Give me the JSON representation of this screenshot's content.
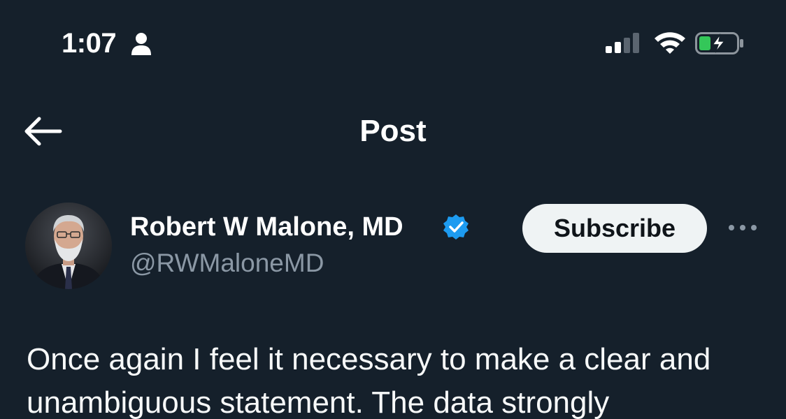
{
  "status_bar": {
    "time": "1:07",
    "icons": [
      "person-icon",
      "cellular-signal-icon",
      "wifi-icon",
      "battery-charging-icon"
    ],
    "battery_color": "#34c759"
  },
  "header": {
    "back_icon": "arrow-left-icon",
    "title": "Post"
  },
  "post": {
    "author": {
      "name": "Robert W Malone, MD",
      "handle": "@RWMaloneMD",
      "verified": true,
      "verified_color": "#1d9bf0"
    },
    "subscribe_label": "Subscribe",
    "more_icon": "ellipsis-icon",
    "text_lines": [
      "Once again I feel it necessary to make a clear and",
      "unambiguous statement. The data strongly"
    ]
  },
  "colors": {
    "background": "#15202b",
    "secondary_text": "#8b98a5",
    "button_bg": "#eff3f4"
  }
}
